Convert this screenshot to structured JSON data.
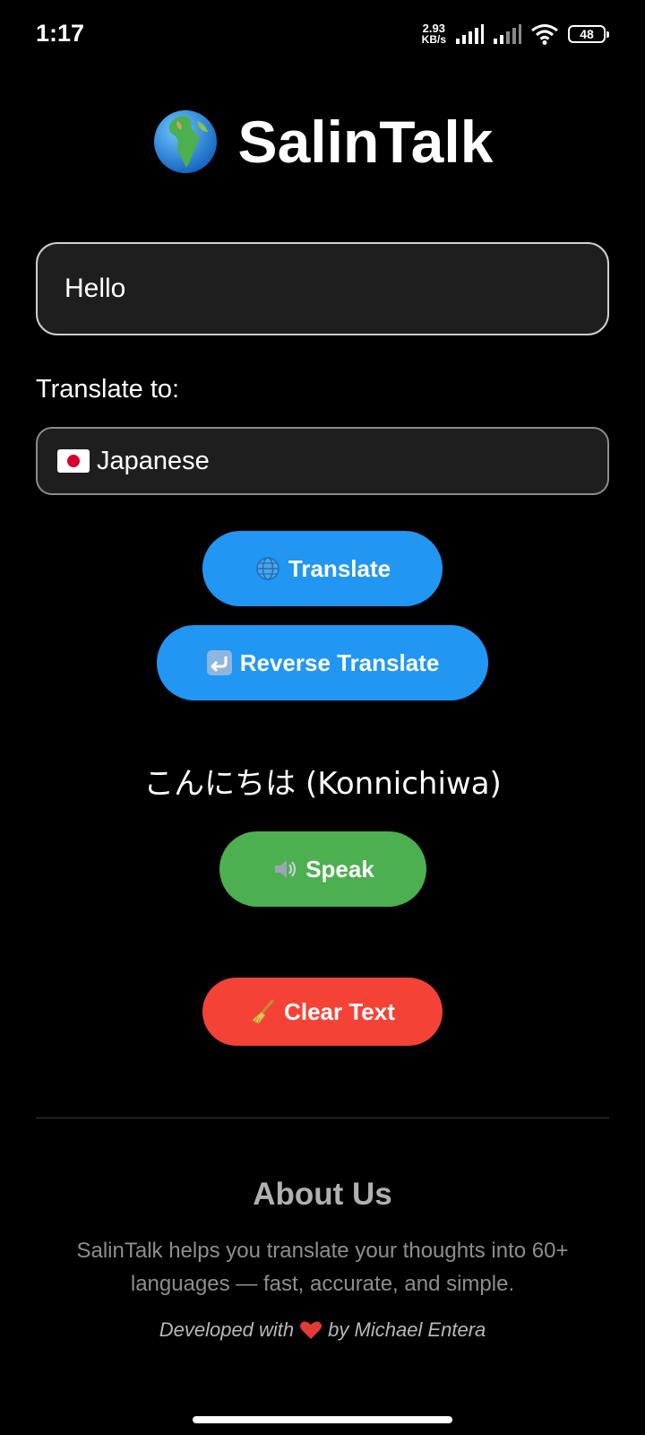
{
  "status_bar": {
    "time": "1:17",
    "net_speed_value": "2.93",
    "net_speed_unit": "KB/s",
    "battery": "48"
  },
  "app": {
    "title": "SalinTalk",
    "title_icon": "globe-icon"
  },
  "form": {
    "input_value": "Hello",
    "translate_to_label": "Translate to:",
    "selected_language": "Japanese",
    "selected_language_flag": "japan-flag-icon"
  },
  "buttons": {
    "translate": "Translate",
    "reverse_translate": "Reverse Translate",
    "speak": "Speak",
    "clear": "Clear Text"
  },
  "result": {
    "text": "こんにちは (Konnichiwa)"
  },
  "about": {
    "title": "About Us",
    "description": "SalinTalk helps you translate your thoughts into 60+ languages — fast, accurate, and simple.",
    "credit_prefix": "Developed with",
    "credit_suffix": "by Michael Entera"
  },
  "colors": {
    "background": "#000000",
    "primary_blue": "#2196f3",
    "speak_green": "#4caf50",
    "clear_red": "#f44336"
  }
}
